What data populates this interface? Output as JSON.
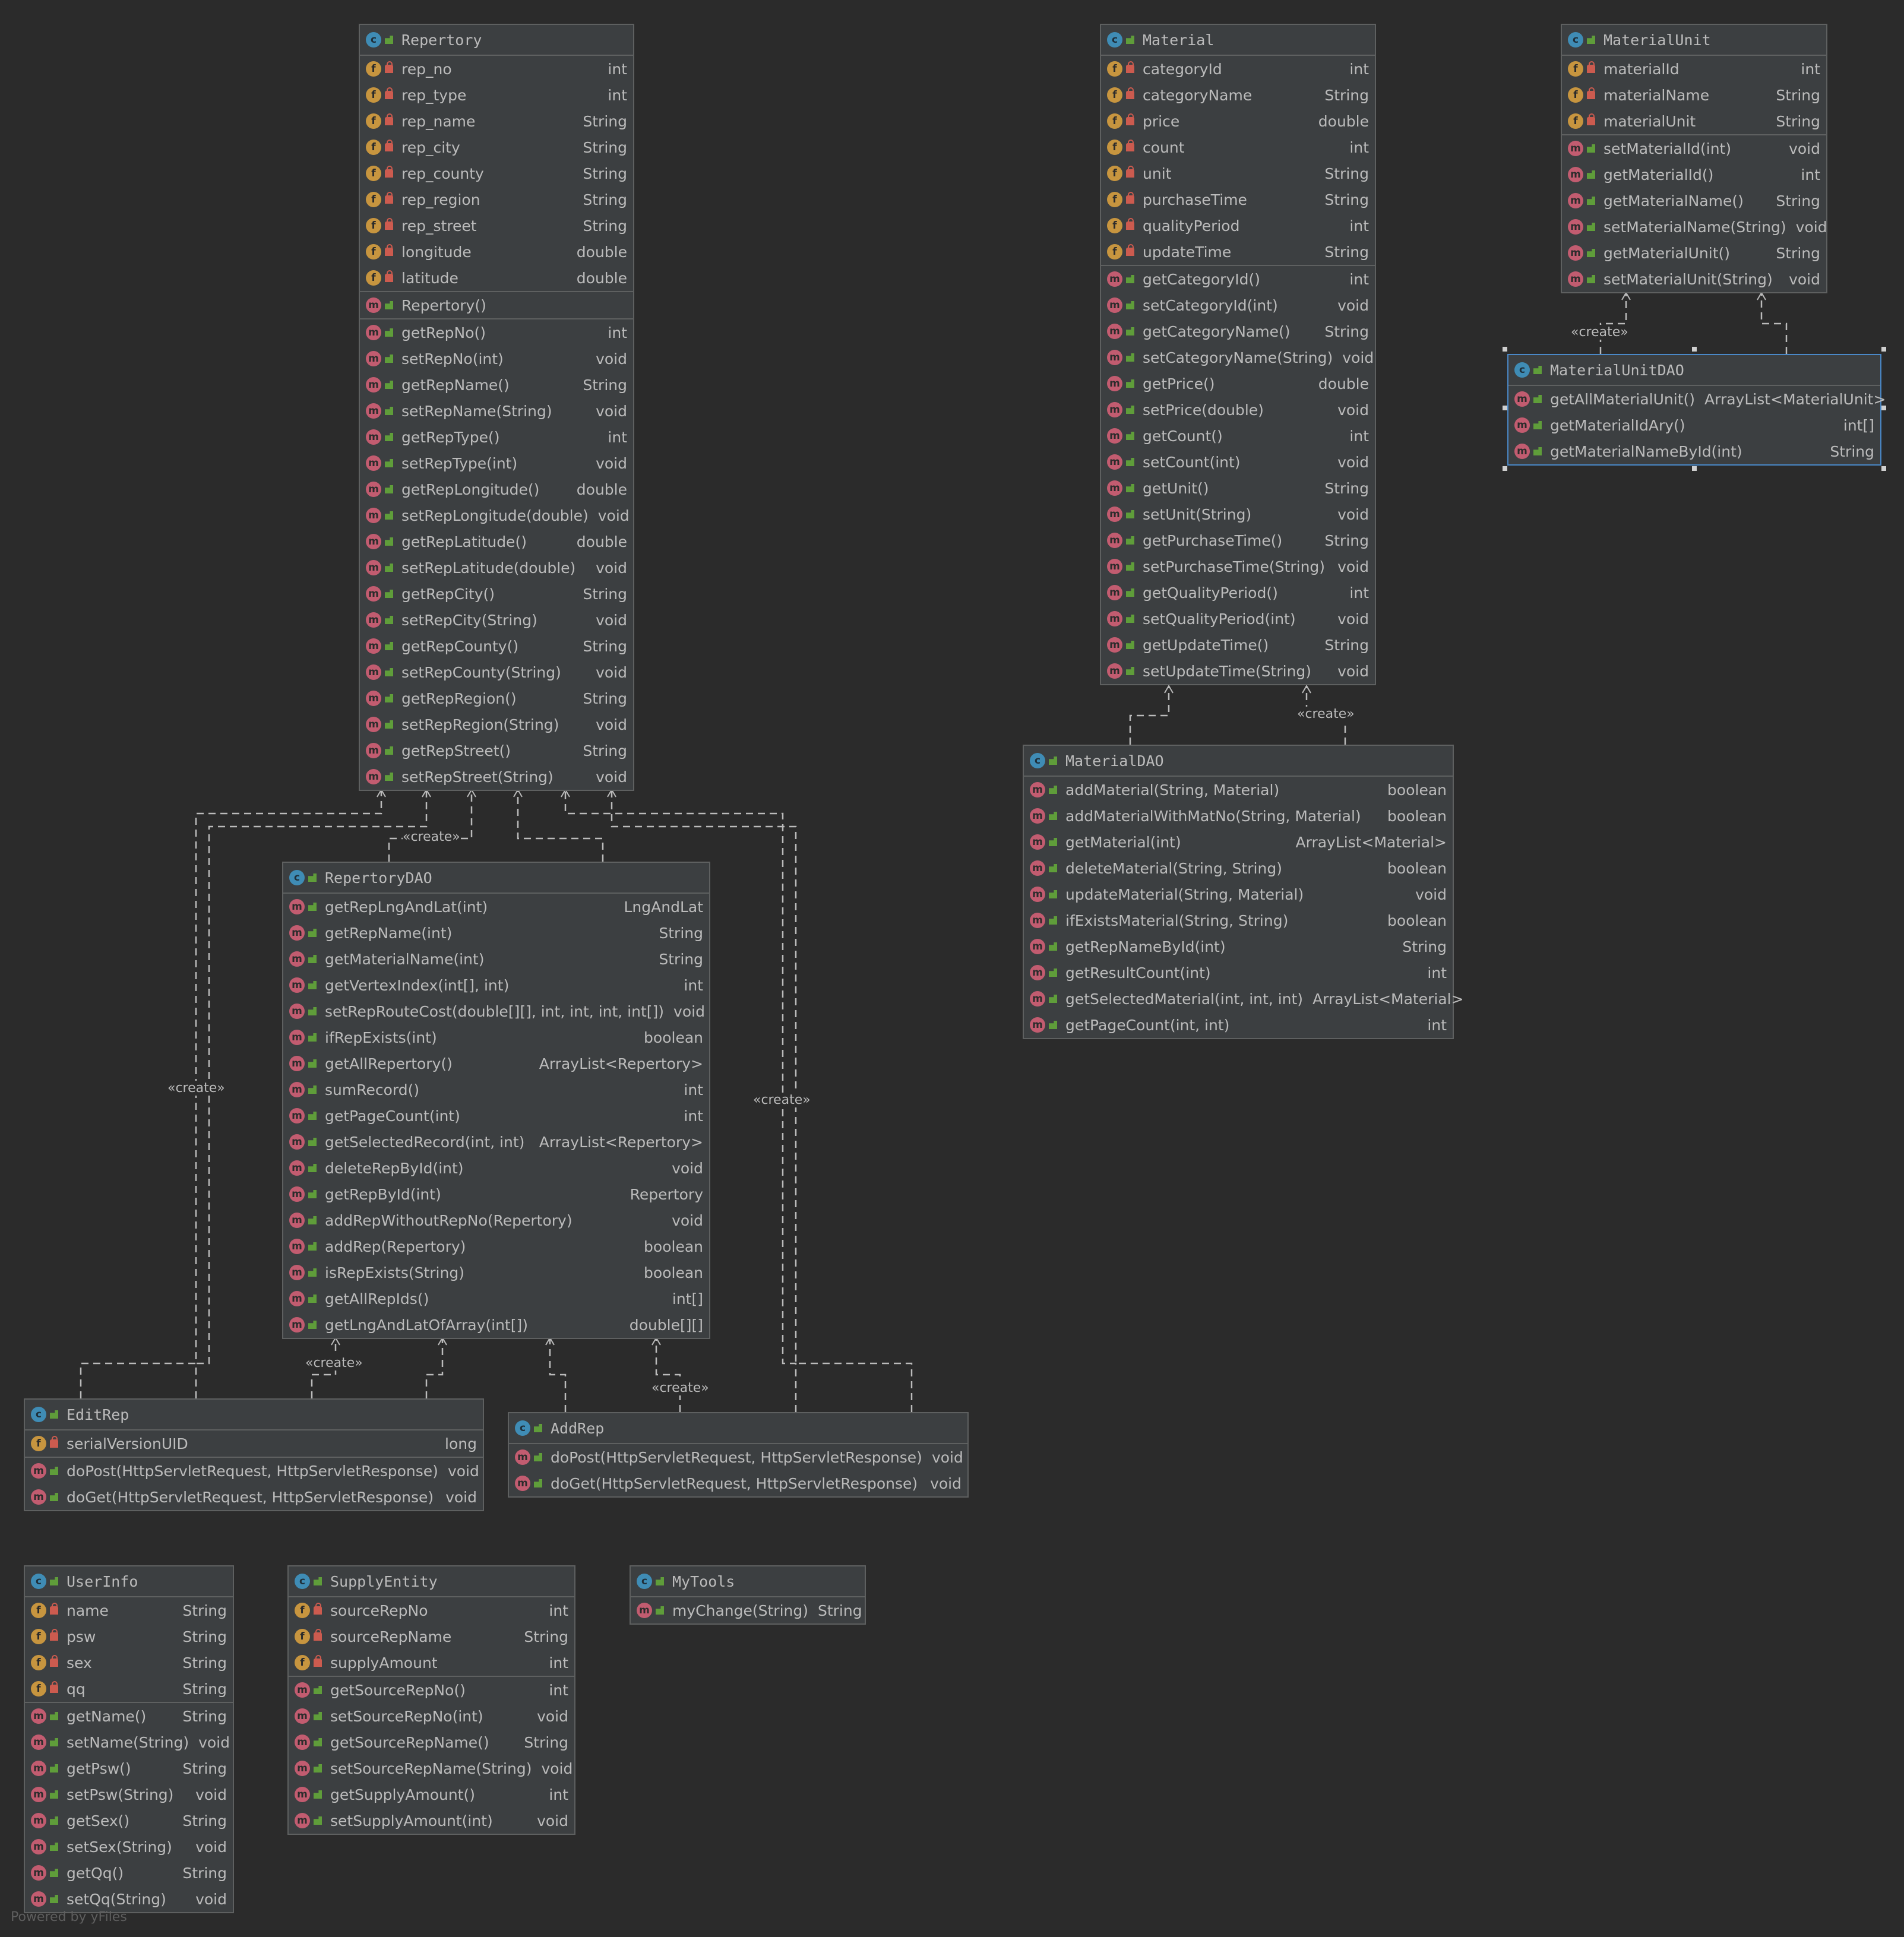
{
  "classes": {
    "repertory": {
      "name": "Repertory",
      "fields": [
        {
          "name": "rep_no",
          "type": "int"
        },
        {
          "name": "rep_type",
          "type": "int"
        },
        {
          "name": "rep_name",
          "type": "String"
        },
        {
          "name": "rep_city",
          "type": "String"
        },
        {
          "name": "rep_county",
          "type": "String"
        },
        {
          "name": "rep_region",
          "type": "String"
        },
        {
          "name": "rep_street",
          "type": "String"
        },
        {
          "name": "longitude",
          "type": "double"
        },
        {
          "name": "latitude",
          "type": "double"
        }
      ],
      "constructors": [
        {
          "name": "Repertory()",
          "type": ""
        }
      ],
      "methods": [
        {
          "name": "getRepNo()",
          "type": "int"
        },
        {
          "name": "setRepNo(int)",
          "type": "void"
        },
        {
          "name": "getRepName()",
          "type": "String"
        },
        {
          "name": "setRepName(String)",
          "type": "void"
        },
        {
          "name": "getRepType()",
          "type": "int"
        },
        {
          "name": "setRepType(int)",
          "type": "void"
        },
        {
          "name": "getRepLongitude()",
          "type": "double"
        },
        {
          "name": "setRepLongitude(double)",
          "type": "void"
        },
        {
          "name": "getRepLatitude()",
          "type": "double"
        },
        {
          "name": "setRepLatitude(double)",
          "type": "void"
        },
        {
          "name": "getRepCity()",
          "type": "String"
        },
        {
          "name": "setRepCity(String)",
          "type": "void"
        },
        {
          "name": "getRepCounty()",
          "type": "String"
        },
        {
          "name": "setRepCounty(String)",
          "type": "void"
        },
        {
          "name": "getRepRegion()",
          "type": "String"
        },
        {
          "name": "setRepRegion(String)",
          "type": "void"
        },
        {
          "name": "getRepStreet()",
          "type": "String"
        },
        {
          "name": "setRepStreet(String)",
          "type": "void"
        }
      ]
    },
    "material": {
      "name": "Material",
      "fields": [
        {
          "name": "categoryId",
          "type": "int"
        },
        {
          "name": "categoryName",
          "type": "String"
        },
        {
          "name": "price",
          "type": "double"
        },
        {
          "name": "count",
          "type": "int"
        },
        {
          "name": "unit",
          "type": "String"
        },
        {
          "name": "purchaseTime",
          "type": "String"
        },
        {
          "name": "qualityPeriod",
          "type": "int"
        },
        {
          "name": "updateTime",
          "type": "String"
        }
      ],
      "methods": [
        {
          "name": "getCategoryId()",
          "type": "int"
        },
        {
          "name": "setCategoryId(int)",
          "type": "void"
        },
        {
          "name": "getCategoryName()",
          "type": "String"
        },
        {
          "name": "setCategoryName(String)",
          "type": "void"
        },
        {
          "name": "getPrice()",
          "type": "double"
        },
        {
          "name": "setPrice(double)",
          "type": "void"
        },
        {
          "name": "getCount()",
          "type": "int"
        },
        {
          "name": "setCount(int)",
          "type": "void"
        },
        {
          "name": "getUnit()",
          "type": "String"
        },
        {
          "name": "setUnit(String)",
          "type": "void"
        },
        {
          "name": "getPurchaseTime()",
          "type": "String"
        },
        {
          "name": "setPurchaseTime(String)",
          "type": "void"
        },
        {
          "name": "getQualityPeriod()",
          "type": "int"
        },
        {
          "name": "setQualityPeriod(int)",
          "type": "void"
        },
        {
          "name": "getUpdateTime()",
          "type": "String"
        },
        {
          "name": "setUpdateTime(String)",
          "type": "void"
        }
      ]
    },
    "materialUnit": {
      "name": "MaterialUnit",
      "fields": [
        {
          "name": "materialId",
          "type": "int"
        },
        {
          "name": "materialName",
          "type": "String"
        },
        {
          "name": "materialUnit",
          "type": "String"
        }
      ],
      "methods": [
        {
          "name": "setMaterialId(int)",
          "type": "void"
        },
        {
          "name": "getMaterialId()",
          "type": "int"
        },
        {
          "name": "getMaterialName()",
          "type": "String"
        },
        {
          "name": "setMaterialName(String)",
          "type": "void"
        },
        {
          "name": "getMaterialUnit()",
          "type": "String"
        },
        {
          "name": "setMaterialUnit(String)",
          "type": "void"
        }
      ]
    },
    "materialUnitDAO": {
      "name": "MaterialUnitDAO",
      "methods": [
        {
          "name": "getAllMaterialUnit()",
          "type": "ArrayList<MaterialUnit>"
        },
        {
          "name": "getMaterialIdAry()",
          "type": "int[]"
        },
        {
          "name": "getMaterialNameById(int)",
          "type": "String"
        }
      ]
    },
    "materialDAO": {
      "name": "MaterialDAO",
      "methods": [
        {
          "name": "addMaterial(String, Material)",
          "type": "boolean"
        },
        {
          "name": "addMaterialWithMatNo(String, Material)",
          "type": "boolean"
        },
        {
          "name": "getMaterial(int)",
          "type": "ArrayList<Material>"
        },
        {
          "name": "deleteMaterial(String, String)",
          "type": "boolean"
        },
        {
          "name": "updateMaterial(String, Material)",
          "type": "void"
        },
        {
          "name": "ifExistsMaterial(String, String)",
          "type": "boolean"
        },
        {
          "name": "getRepNameById(int)",
          "type": "String"
        },
        {
          "name": "getResultCount(int)",
          "type": "int"
        },
        {
          "name": "getSelectedMaterial(int, int, int)",
          "type": "ArrayList<Material>"
        },
        {
          "name": "getPageCount(int, int)",
          "type": "int"
        }
      ]
    },
    "repertoryDAO": {
      "name": "RepertoryDAO",
      "methods": [
        {
          "name": "getRepLngAndLat(int)",
          "type": "LngAndLat"
        },
        {
          "name": "getRepName(int)",
          "type": "String"
        },
        {
          "name": "getMaterialName(int)",
          "type": "String"
        },
        {
          "name": "getVertexIndex(int[], int)",
          "type": "int"
        },
        {
          "name": "setRepRouteCost(double[][], int, int, int, int[])",
          "type": "void"
        },
        {
          "name": "ifRepExists(int)",
          "type": "boolean"
        },
        {
          "name": "getAllRepertory()",
          "type": "ArrayList<Repertory>"
        },
        {
          "name": "sumRecord()",
          "type": "int"
        },
        {
          "name": "getPageCount(int)",
          "type": "int"
        },
        {
          "name": "getSelectedRecord(int, int)",
          "type": "ArrayList<Repertory>"
        },
        {
          "name": "deleteRepById(int)",
          "type": "void"
        },
        {
          "name": "getRepById(int)",
          "type": "Repertory"
        },
        {
          "name": "addRepWithoutRepNo(Repertory)",
          "type": "void"
        },
        {
          "name": "addRep(Repertory)",
          "type": "boolean"
        },
        {
          "name": "isRepExists(String)",
          "type": "boolean"
        },
        {
          "name": "getAllRepIds()",
          "type": "int[]"
        },
        {
          "name": "getLngAndLatOfArray(int[])",
          "type": "double[][]"
        }
      ]
    },
    "editRep": {
      "name": "EditRep",
      "fields": [
        {
          "name": "serialVersionUID",
          "type": "long"
        }
      ],
      "methods": [
        {
          "name": "doPost(HttpServletRequest, HttpServletResponse)",
          "type": "void"
        },
        {
          "name": "doGet(HttpServletRequest, HttpServletResponse)",
          "type": "void"
        }
      ]
    },
    "addRep": {
      "name": "AddRep",
      "methods": [
        {
          "name": "doPost(HttpServletRequest, HttpServletResponse)",
          "type": "void"
        },
        {
          "name": "doGet(HttpServletRequest, HttpServletResponse)",
          "type": "void"
        }
      ]
    },
    "userInfo": {
      "name": "UserInfo",
      "fields": [
        {
          "name": "name",
          "type": "String"
        },
        {
          "name": "psw",
          "type": "String"
        },
        {
          "name": "sex",
          "type": "String"
        },
        {
          "name": "qq",
          "type": "String"
        }
      ],
      "methods": [
        {
          "name": "getName()",
          "type": "String"
        },
        {
          "name": "setName(String)",
          "type": "void"
        },
        {
          "name": "getPsw()",
          "type": "String"
        },
        {
          "name": "setPsw(String)",
          "type": "void"
        },
        {
          "name": "getSex()",
          "type": "String"
        },
        {
          "name": "setSex(String)",
          "type": "void"
        },
        {
          "name": "getQq()",
          "type": "String"
        },
        {
          "name": "setQq(String)",
          "type": "void"
        }
      ]
    },
    "supplyEntity": {
      "name": "SupplyEntity",
      "fields": [
        {
          "name": "sourceRepNo",
          "type": "int"
        },
        {
          "name": "sourceRepName",
          "type": "String"
        },
        {
          "name": "supplyAmount",
          "type": "int"
        }
      ],
      "methods": [
        {
          "name": "getSourceRepNo()",
          "type": "int"
        },
        {
          "name": "setSourceRepNo(int)",
          "type": "void"
        },
        {
          "name": "getSourceRepName()",
          "type": "String"
        },
        {
          "name": "setSourceRepName(String)",
          "type": "void"
        },
        {
          "name": "getSupplyAmount()",
          "type": "int"
        },
        {
          "name": "setSupplyAmount(int)",
          "type": "void"
        }
      ]
    },
    "myTools": {
      "name": "MyTools",
      "methods": [
        {
          "name": "myChange(String)",
          "type": "String"
        }
      ]
    }
  },
  "edge_labels": {
    "create": "«create»"
  },
  "footer": "Powered by yFiles",
  "colors": {
    "background": "#2b2b2b",
    "box": "#3c3f41",
    "border": "#5e6060",
    "selected_border": "#4a88c7",
    "class_icon": "#3f8cb5",
    "field_icon": "#c7953f",
    "method_icon": "#c25c70",
    "public": "#5f9d3a",
    "private": "#cc5b4f"
  }
}
